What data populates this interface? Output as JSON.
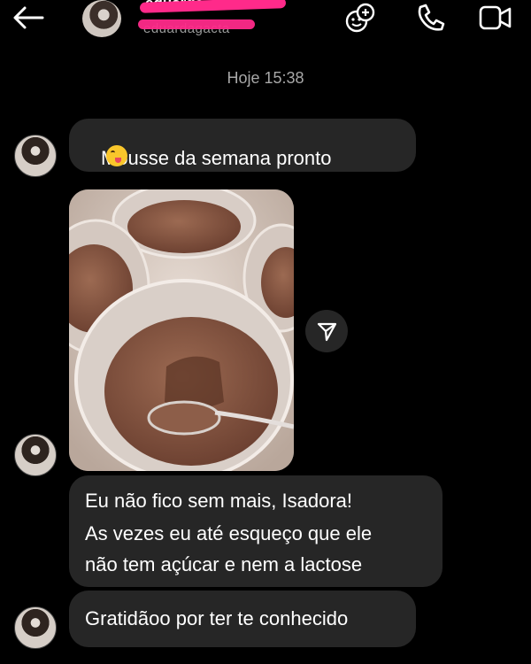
{
  "header": {
    "username": "eduarda",
    "subname": "eduardagacta"
  },
  "timestamp": "Hoje 15:38",
  "messages": {
    "m1": "Mousse da semana pronto",
    "m3_lines": [
      "Eu não fico sem mais, Isadora!",
      "As vezes eu até esqueço que ele",
      "não tem açúcar e nem a lactose"
    ],
    "m4": "Gratidãoo por ter te conhecido"
  },
  "icons": {
    "back": "arrow-left-icon",
    "effects": "effects-icon",
    "phone": "phone-icon",
    "video": "video-camera-icon",
    "share": "send-icon"
  },
  "colors": {
    "background": "#000000",
    "bubble": "#262626",
    "redaction": "#ff2a8a"
  }
}
